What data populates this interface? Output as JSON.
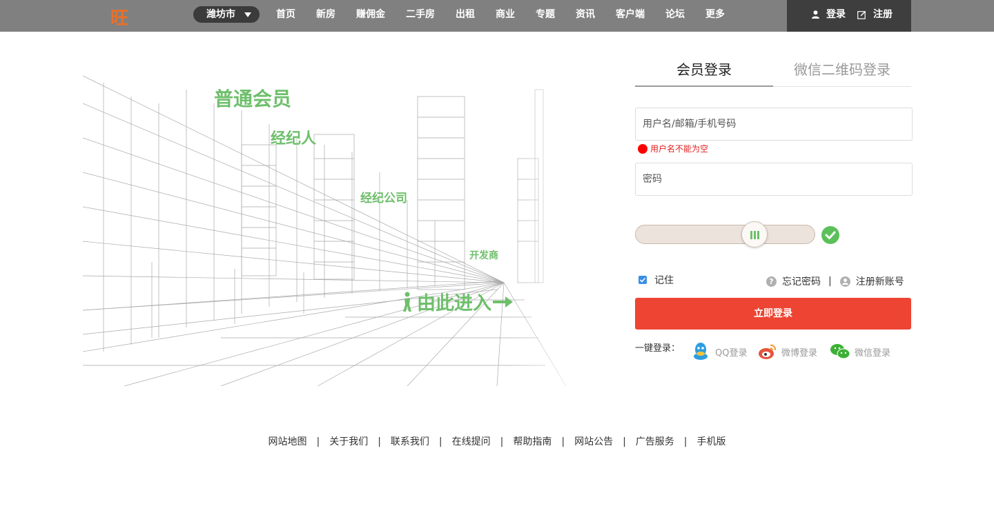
{
  "header": {
    "logo": "旺",
    "city": "潍坊市",
    "nav": [
      "首页",
      "新房",
      "赚佣金",
      "二手房",
      "出租",
      "商业",
      "专题",
      "资讯",
      "客户端",
      "论坛",
      "更多"
    ],
    "login": "登录",
    "register": "注册"
  },
  "illustration": {
    "member": "普通会员",
    "agent": "经纪人",
    "agency": "经纪公司",
    "developer": "开发商",
    "enter": "由此进入"
  },
  "login_panel": {
    "tab_member": "会员登录",
    "tab_wechat_qr": "微信二维码登录",
    "username_placeholder": "用户名/邮箱/手机号码",
    "username_error": "用户名不能为空",
    "password_placeholder": "密码",
    "remember": "记住",
    "forgot_password": "忘记密码",
    "link_separator": "|",
    "register_new": "注册新账号",
    "submit": "立即登录",
    "one_click_label": "一键登录：",
    "qq_login": "QQ登录",
    "weibo_login": "微博登录",
    "wechat_login": "微信登录"
  },
  "footer": {
    "links": [
      "网站地图",
      "关于我们",
      "联系我们",
      "在线提问",
      "帮助指南",
      "网站公告",
      "广告服务",
      "手机版"
    ],
    "separator": "|"
  },
  "colors": {
    "accent": "#ee4433",
    "header_bg": "#808080",
    "green": "#6ebf6b",
    "logo": "#e8702a"
  }
}
